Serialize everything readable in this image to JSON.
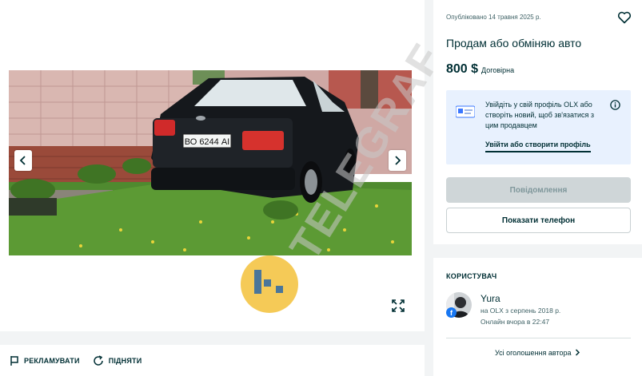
{
  "listing": {
    "published": "Опубліковано 14 травня 2025 р.",
    "title": "Продам або обміняю авто",
    "price": "800 $",
    "price_note": "Договірна",
    "plate": "ВО 6244 АІ"
  },
  "info_box": {
    "text": "Увійдіть у свій профіль OLX або створіть новий, щоб зв'язатися з цим продавцем",
    "link": "Увійти або створити профіль"
  },
  "buttons": {
    "message": "Повідомлення",
    "phone": "Показати телефон"
  },
  "user": {
    "heading": "КОРИСТУВАЧ",
    "name": "Yura",
    "since": "на OLX з серпень 2018 р.",
    "online": "Онлайн вчора в 22:47",
    "all_ads": "Усі оголошення автора"
  },
  "actions": {
    "promote": "РЕКЛАМУВАТИ",
    "bump": "ПІДНЯТИ"
  },
  "watermark": {
    "text": "TELEGRAF"
  },
  "icons": {
    "favorite": "heart-icon",
    "prev": "chevron-left-icon",
    "next": "chevron-right-icon",
    "fullscreen": "expand-icon",
    "info": "info-icon",
    "promote": "flag-icon",
    "bump": "refresh-icon"
  },
  "colors": {
    "text": "#002f34",
    "info_bg": "#e8f1fe",
    "disabled_btn": "#cfd6d8",
    "watermark": "#f3c13a"
  }
}
